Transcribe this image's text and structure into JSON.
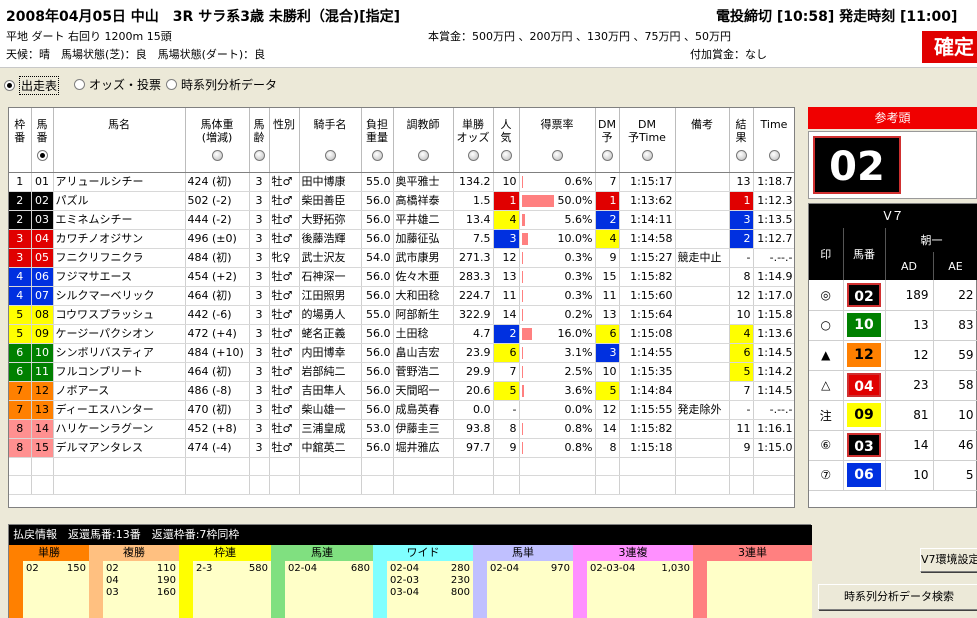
{
  "header": {
    "race_title": "2008年04月05日 中山　3R サラ系3歳 未勝利（混合)[指定]",
    "deadline": "電投締切 [10:58] 発走時刻 [11:00]",
    "course": "平地 ダート 右回り 1200m 15頭",
    "weather": "天候：晴　馬場状態(芝)：良　馬場状態(ダート)：良",
    "prize": "本賞金：500万円 、200万円 、130万円 、75万円 、50万円",
    "extra_prize": "付加賞金：なし",
    "confirm": "確定"
  },
  "tabs": [
    {
      "label": "出走表",
      "selected": true
    },
    {
      "label": "オッズ・投票",
      "selected": false
    },
    {
      "label": "時系列分析データ",
      "selected": false
    }
  ],
  "table": {
    "columns": [
      "枠番",
      "馬番",
      "馬名",
      "馬体重(増減)",
      "馬齢",
      "性別",
      "騎手名",
      "負担重量",
      "調教師",
      "単勝オッズ",
      "人気",
      "得票率",
      "DM予",
      "DM予Time",
      "備考",
      "結果",
      "Time"
    ],
    "rows": [
      {
        "waku": "1",
        "uma": "01",
        "name": "アリュールシチー",
        "weight": "424 (初)",
        "age": "3",
        "sex": "牡♂",
        "jockey": "田中博康",
        "load": "55.0",
        "trainer": "奥平雅士",
        "odds": "134.2",
        "pop": "10",
        "rate": "0.6%",
        "rate_value": 0.6,
        "dm": "7",
        "dmtime": "1:15:17",
        "note": "",
        "result": "13",
        "time": "1:18.7"
      },
      {
        "waku": "2",
        "uma": "02",
        "name": "パズル",
        "weight": "502 (-2)",
        "age": "3",
        "sex": "牡♂",
        "jockey": "柴田善臣",
        "load": "56.0",
        "trainer": "高橋祥泰",
        "odds": "1.5",
        "pop": "1",
        "rate": "50.0%",
        "rate_value": 50.0,
        "dm": "1",
        "dmtime": "1:13:62",
        "note": "",
        "result": "1",
        "time": "1:12.3"
      },
      {
        "waku": "2",
        "uma": "03",
        "name": "エミネムシチー",
        "weight": "444 (-2)",
        "age": "3",
        "sex": "牡♂",
        "jockey": "大野拓弥",
        "load": "56.0",
        "trainer": "平井雄二",
        "odds": "13.4",
        "pop": "4",
        "rate": "5.6%",
        "rate_value": 5.6,
        "dm": "2",
        "dmtime": "1:14:11",
        "note": "",
        "result": "3",
        "time": "1:13.5"
      },
      {
        "waku": "3",
        "uma": "04",
        "name": "カワチノオジサン",
        "weight": "496 (±0)",
        "age": "3",
        "sex": "牡♂",
        "jockey": "後藤浩輝",
        "load": "56.0",
        "trainer": "加藤征弘",
        "odds": "7.5",
        "pop": "3",
        "rate": "10.0%",
        "rate_value": 10.0,
        "dm": "4",
        "dmtime": "1:14:58",
        "note": "",
        "result": "2",
        "time": "1:12.7"
      },
      {
        "waku": "3",
        "uma": "05",
        "name": "フニクリフニクラ",
        "weight": "484 (初)",
        "age": "3",
        "sex": "牝♀",
        "jockey": "武士沢友",
        "load": "54.0",
        "trainer": "武市康男",
        "odds": "271.3",
        "pop": "12",
        "rate": "0.3%",
        "rate_value": 0.3,
        "dm": "9",
        "dmtime": "1:15:27",
        "note": "競走中止",
        "result": "-",
        "time": "-.--.-"
      },
      {
        "waku": "4",
        "uma": "06",
        "name": "フジマサエース",
        "weight": "454 (+2)",
        "age": "3",
        "sex": "牡♂",
        "jockey": "石神深一",
        "load": "56.0",
        "trainer": "佐々木亜",
        "odds": "283.3",
        "pop": "13",
        "rate": "0.3%",
        "rate_value": 0.3,
        "dm": "15",
        "dmtime": "1:15:82",
        "note": "",
        "result": "8",
        "time": "1:14.9"
      },
      {
        "waku": "4",
        "uma": "07",
        "name": "シルクマーベリック",
        "weight": "464 (初)",
        "age": "3",
        "sex": "牡♂",
        "jockey": "江田照男",
        "load": "56.0",
        "trainer": "大和田稔",
        "odds": "224.7",
        "pop": "11",
        "rate": "0.3%",
        "rate_value": 0.3,
        "dm": "11",
        "dmtime": "1:15:60",
        "note": "",
        "result": "12",
        "time": "1:17.0"
      },
      {
        "waku": "5",
        "uma": "08",
        "name": "コウワスプラッシュ",
        "weight": "442 (-6)",
        "age": "3",
        "sex": "牡♂",
        "jockey": "的場勇人",
        "load": "55.0",
        "trainer": "阿部新生",
        "odds": "322.9",
        "pop": "14",
        "rate": "0.2%",
        "rate_value": 0.2,
        "dm": "13",
        "dmtime": "1:15:64",
        "note": "",
        "result": "10",
        "time": "1:15.8"
      },
      {
        "waku": "5",
        "uma": "09",
        "name": "ケージーパクシオン",
        "weight": "472 (+4)",
        "age": "3",
        "sex": "牡♂",
        "jockey": "蛯名正義",
        "load": "56.0",
        "trainer": "土田稔",
        "odds": "4.7",
        "pop": "2",
        "rate": "16.0%",
        "rate_value": 16.0,
        "dm": "6",
        "dmtime": "1:15:08",
        "note": "",
        "result": "4",
        "time": "1:13.6"
      },
      {
        "waku": "6",
        "uma": "10",
        "name": "シンボリバスティア",
        "weight": "484 (+10)",
        "age": "3",
        "sex": "牡♂",
        "jockey": "内田博幸",
        "load": "56.0",
        "trainer": "畠山吉宏",
        "odds": "23.9",
        "pop": "6",
        "rate": "3.1%",
        "rate_value": 3.1,
        "dm": "3",
        "dmtime": "1:14:55",
        "note": "",
        "result": "6",
        "time": "1:14.5"
      },
      {
        "waku": "6",
        "uma": "11",
        "name": "フルコンプリート",
        "weight": "464 (初)",
        "age": "3",
        "sex": "牡♂",
        "jockey": "岩部純二",
        "load": "56.0",
        "trainer": "菅野浩二",
        "odds": "29.9",
        "pop": "7",
        "rate": "2.5%",
        "rate_value": 2.5,
        "dm": "10",
        "dmtime": "1:15:35",
        "note": "",
        "result": "5",
        "time": "1:14.2"
      },
      {
        "waku": "7",
        "uma": "12",
        "name": "ノボアース",
        "weight": "486 (-8)",
        "age": "3",
        "sex": "牡♂",
        "jockey": "吉田隼人",
        "load": "56.0",
        "trainer": "天間昭一",
        "odds": "20.6",
        "pop": "5",
        "rate": "3.6%",
        "rate_value": 3.6,
        "dm": "5",
        "dmtime": "1:14:84",
        "note": "",
        "result": "7",
        "time": "1:14.5"
      },
      {
        "waku": "7",
        "uma": "13",
        "name": "ディーエスハンター",
        "weight": "470 (初)",
        "age": "3",
        "sex": "牡♂",
        "jockey": "柴山雄一",
        "load": "56.0",
        "trainer": "成島英春",
        "odds": "0.0",
        "pop": "-",
        "rate": "0.0%",
        "rate_value": 0.0,
        "dm": "12",
        "dmtime": "1:15:55",
        "note": "発走除外",
        "result": "-",
        "time": "-.--.-"
      },
      {
        "waku": "8",
        "uma": "14",
        "name": "ハリケーンラグーン",
        "weight": "452 (+8)",
        "age": "3",
        "sex": "牡♂",
        "jockey": "三浦皇成",
        "load": "53.0",
        "trainer": "伊藤圭三",
        "odds": "93.8",
        "pop": "8",
        "rate": "0.8%",
        "rate_value": 0.8,
        "dm": "14",
        "dmtime": "1:15:82",
        "note": "",
        "result": "11",
        "time": "1:16.1"
      },
      {
        "waku": "8",
        "uma": "15",
        "name": "デルマアンタレス",
        "weight": "474 (-4)",
        "age": "3",
        "sex": "牡♂",
        "jockey": "中舘英二",
        "load": "56.0",
        "trainer": "堀井雅広",
        "odds": "97.7",
        "pop": "9",
        "rate": "0.8%",
        "rate_value": 0.8,
        "dm": "8",
        "dmtime": "1:15:18",
        "note": "",
        "result": "9",
        "time": "1:15.0"
      }
    ]
  },
  "reference": {
    "label": "参考頭",
    "number": "02"
  },
  "v7": {
    "title": "V７",
    "sub": "朝一",
    "col_mark": "印",
    "col_uma": "馬番",
    "col_ad": "AD",
    "col_ae": "AE",
    "rows": [
      {
        "mark": "◎",
        "uma": "02",
        "waku_class": "w1",
        "ad": "189",
        "ae": "22",
        "hl": true
      },
      {
        "mark": "○",
        "uma": "10",
        "waku_class": "w5",
        "ad": "13",
        "ae": "83",
        "hl": false
      },
      {
        "mark": "▲",
        "uma": "12",
        "waku_class": "w6",
        "ad": "12",
        "ae": "59",
        "hl": false
      },
      {
        "mark": "△",
        "uma": "04",
        "waku_class": "w2",
        "ad": "23",
        "ae": "58",
        "hl": true
      },
      {
        "mark": "注",
        "uma": "09",
        "waku_class": "w4",
        "ad": "81",
        "ae": "10",
        "hl": false
      },
      {
        "mark": "⑥",
        "uma": "03",
        "waku_class": "w1",
        "ad": "14",
        "ae": "46",
        "hl": true
      },
      {
        "mark": "⑦",
        "uma": "06",
        "waku_class": "w3",
        "ad": "10",
        "ae": "5",
        "hl": false
      }
    ]
  },
  "payout": {
    "header": "払戻情報　返還馬番:13番　返還枠番:7枠同枠",
    "columns": [
      {
        "label": "単勝",
        "color": "#ff8000",
        "rows": [
          [
            "02",
            "150"
          ]
        ]
      },
      {
        "label": "複勝",
        "color": "#ffc080",
        "rows": [
          [
            "02",
            "110"
          ],
          [
            "04",
            "190"
          ],
          [
            "03",
            "160"
          ]
        ]
      },
      {
        "label": "枠連",
        "color": "#ffff00",
        "rows": [
          [
            "2-3",
            "580"
          ]
        ]
      },
      {
        "label": "馬連",
        "color": "#80e080",
        "rows": [
          [
            "02-04",
            "680"
          ]
        ]
      },
      {
        "label": "ワイド",
        "color": "#80ffff",
        "rows": [
          [
            "02-04",
            "280"
          ],
          [
            "02-03",
            "230"
          ],
          [
            "03-04",
            "800"
          ]
        ]
      },
      {
        "label": "馬単",
        "color": "#c0c0ff",
        "rows": [
          [
            "02-04",
            "970"
          ]
        ]
      },
      {
        "label": "3連複",
        "color": "#ff90ff",
        "rows": [
          [
            "02-03-04",
            "1,030"
          ]
        ]
      },
      {
        "label": "3連単",
        "color": "#ff8080",
        "rows": []
      }
    ]
  },
  "buttons": {
    "v7_settings": "V7環境設定",
    "timeseries_search": "時系列分析データ検索"
  }
}
